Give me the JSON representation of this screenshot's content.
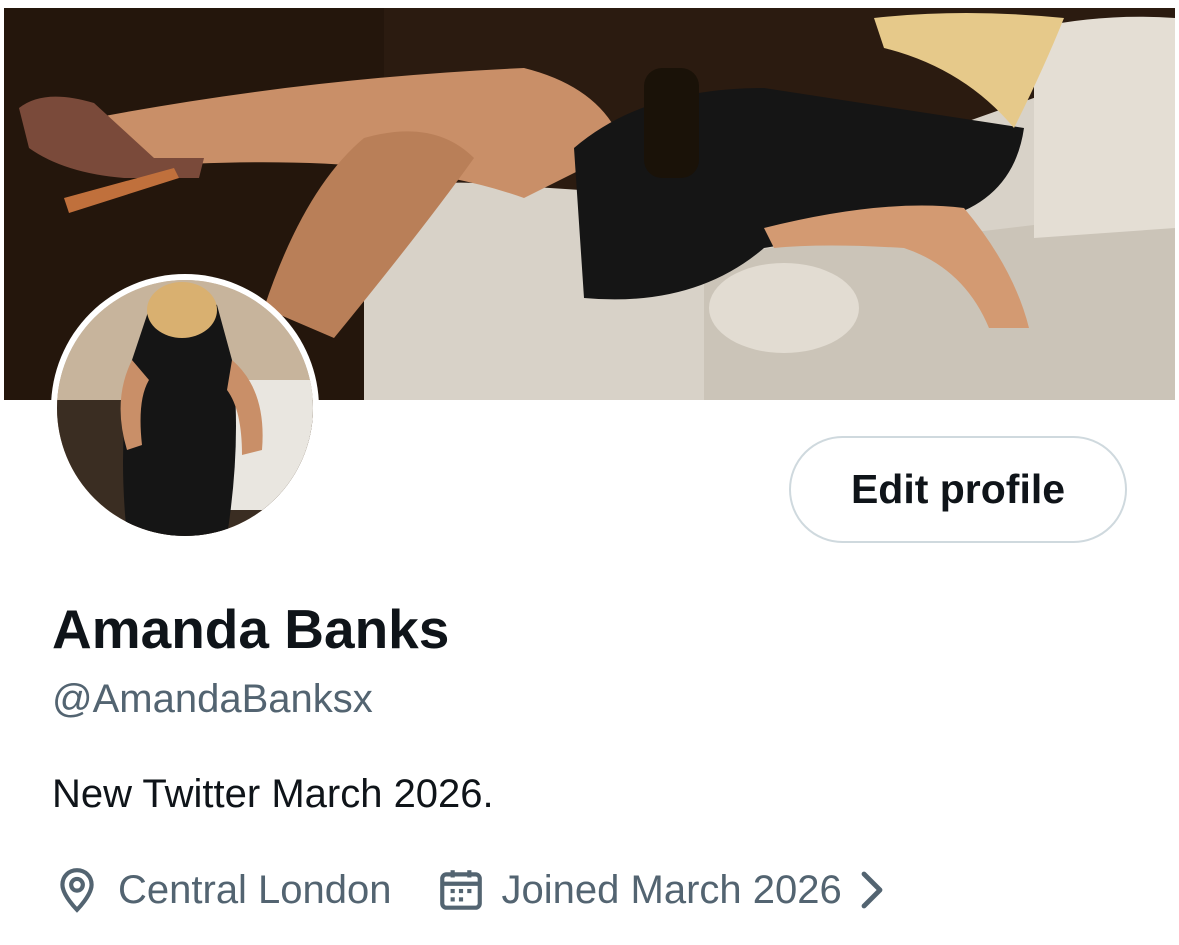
{
  "profile": {
    "display_name": "Amanda Banks",
    "handle": "@AmandaBanksx",
    "bio": "New Twitter March 2026.",
    "location": "Central London",
    "joined": "Joined March 2026"
  },
  "actions": {
    "edit_profile_label": "Edit profile"
  },
  "icons": {
    "location": "location-pin-icon",
    "joined": "calendar-icon",
    "expand": "chevron-right-icon"
  },
  "colors": {
    "primary_text": "#0f1419",
    "secondary_text": "#536471",
    "button_border": "#cfd9de"
  }
}
